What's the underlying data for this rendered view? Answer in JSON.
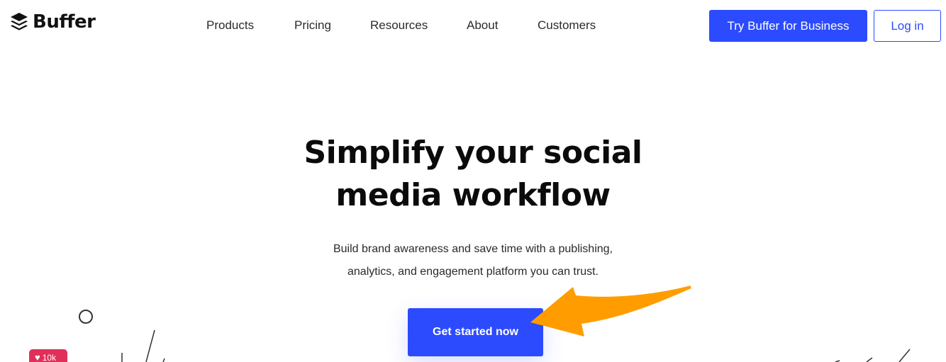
{
  "header": {
    "logo_text": "Buffer",
    "nav": [
      {
        "label": "Products"
      },
      {
        "label": "Pricing"
      },
      {
        "label": "Resources"
      },
      {
        "label": "About"
      },
      {
        "label": "Customers"
      }
    ],
    "try_business_label": "Try Buffer for Business",
    "login_label": "Log in"
  },
  "hero": {
    "title_line1": "Simplify your social",
    "title_line2": "media workflow",
    "subtitle_line1": "Build brand awareness and save time with a publishing,",
    "subtitle_line2": "analytics, and engagement platform you can trust.",
    "cta_label": "Get started now"
  },
  "decor": {
    "like_count": "10k",
    "heart_icon": "heart-icon",
    "arrow_icon": "arrow-annotation-icon"
  },
  "colors": {
    "brand_blue": "#2c4bff",
    "arrow_orange": "#ff9d00",
    "like_pink": "#e0305a"
  }
}
